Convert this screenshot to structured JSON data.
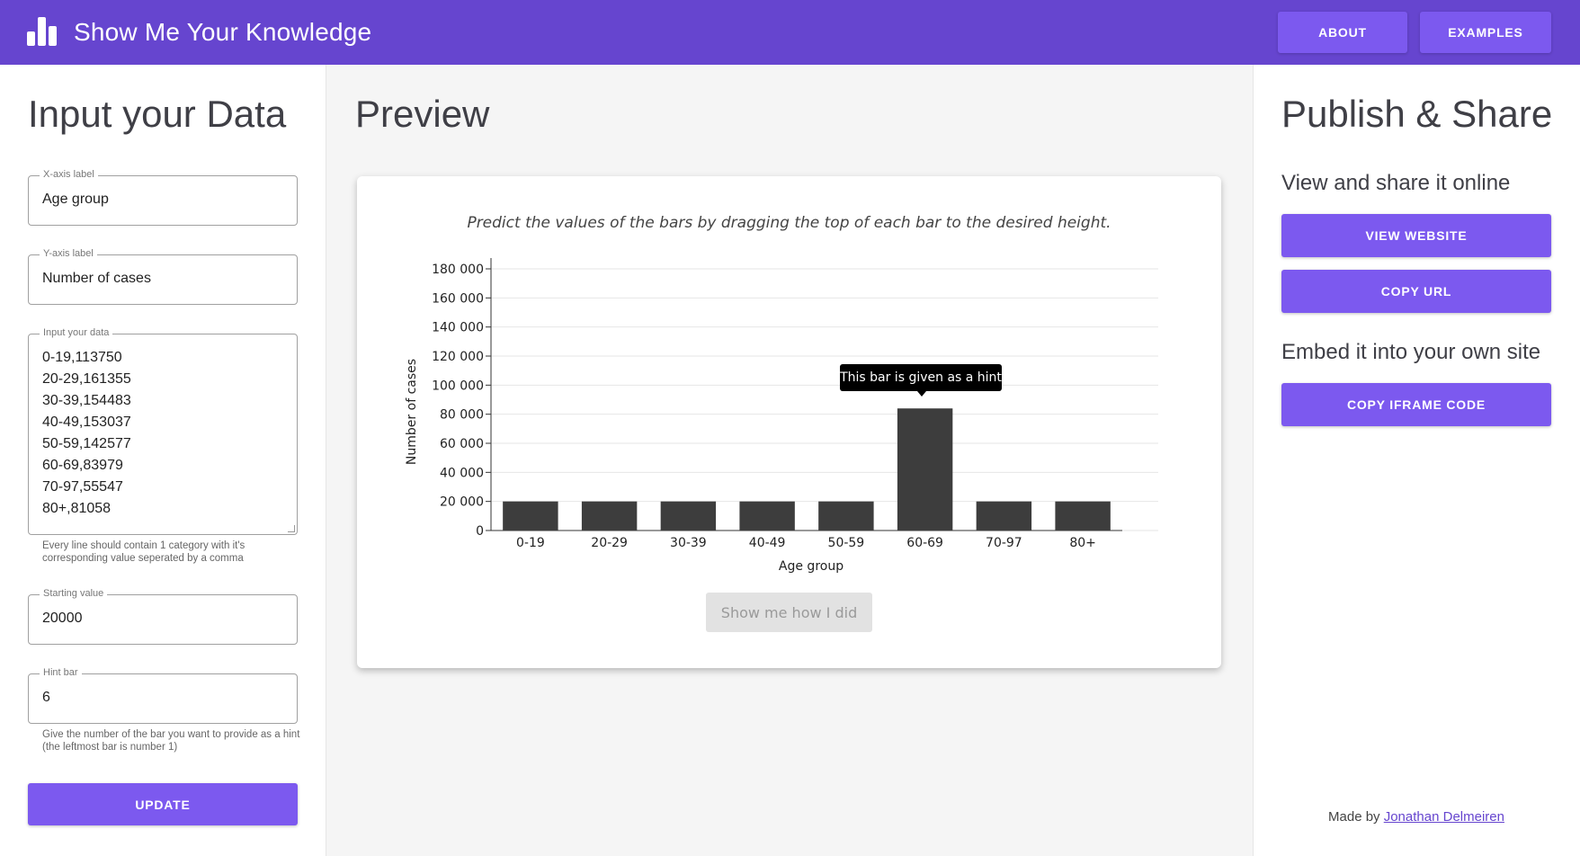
{
  "header": {
    "title": "Show Me Your Knowledge",
    "logo_icon": "bar-chart-icon",
    "nav": {
      "about": "ABOUT",
      "examples": "EXAMPLES"
    },
    "color": "#6645cf"
  },
  "input_panel": {
    "title": "Input your Data",
    "x_axis_label": {
      "legend": "X-axis label",
      "value": "Age group"
    },
    "y_axis_label": {
      "legend": "Y-axis label",
      "value": "Number of cases"
    },
    "data": {
      "legend": "Input your data",
      "value": "0-19,113750\n20-29,161355\n30-39,154483\n40-49,153037\n50-59,142577\n60-69,83979\n70-97,55547\n80+,81058",
      "helper": "Every line should contain 1 category with it's corresponding value seperated by a comma"
    },
    "starting_value": {
      "legend": "Starting value",
      "value": "20000"
    },
    "hint_bar": {
      "legend": "Hint bar",
      "value": "6",
      "helper": "Give the number of the bar you want to provide as a hint (the leftmost bar is number 1)"
    },
    "update_label": "UPDATE"
  },
  "preview": {
    "title": "Preview",
    "instruction": "Predict the values of the bars by dragging the top of each bar to the desired height.",
    "tooltip": "This bar is given as a hint",
    "show_button": "Show me how I did"
  },
  "chart_data": {
    "type": "bar",
    "categories": [
      "0-19",
      "20-29",
      "30-39",
      "40-49",
      "50-59",
      "60-69",
      "70-97",
      "80+"
    ],
    "values": [
      20000,
      20000,
      20000,
      20000,
      20000,
      83979,
      20000,
      20000
    ],
    "xlabel": "Age group",
    "ylabel": "Number of cases",
    "ylim": [
      0,
      180000
    ],
    "yticks": [
      0,
      20000,
      40000,
      60000,
      80000,
      100000,
      120000,
      140000,
      160000,
      180000
    ],
    "ytick_labels": [
      "0",
      "20 000",
      "40 000",
      "60 000",
      "80 000",
      "100 000",
      "120 000",
      "140 000",
      "160 000",
      "180 000"
    ],
    "grid": true,
    "bar_color": "#3d3d3d",
    "hint_index": 5
  },
  "publish_panel": {
    "title": "Publish & Share",
    "view_heading": "View and share it online",
    "view_website": "VIEW WEBSITE",
    "copy_url": "COPY URL",
    "embed_heading": "Embed it into your own site",
    "copy_iframe": "COPY IFRAME CODE",
    "made_by_prefix": "Made by ",
    "made_by_name": "Jonathan Delmeiren"
  },
  "colors": {
    "primary": "#7c59ef",
    "appbar": "#6645cf"
  }
}
